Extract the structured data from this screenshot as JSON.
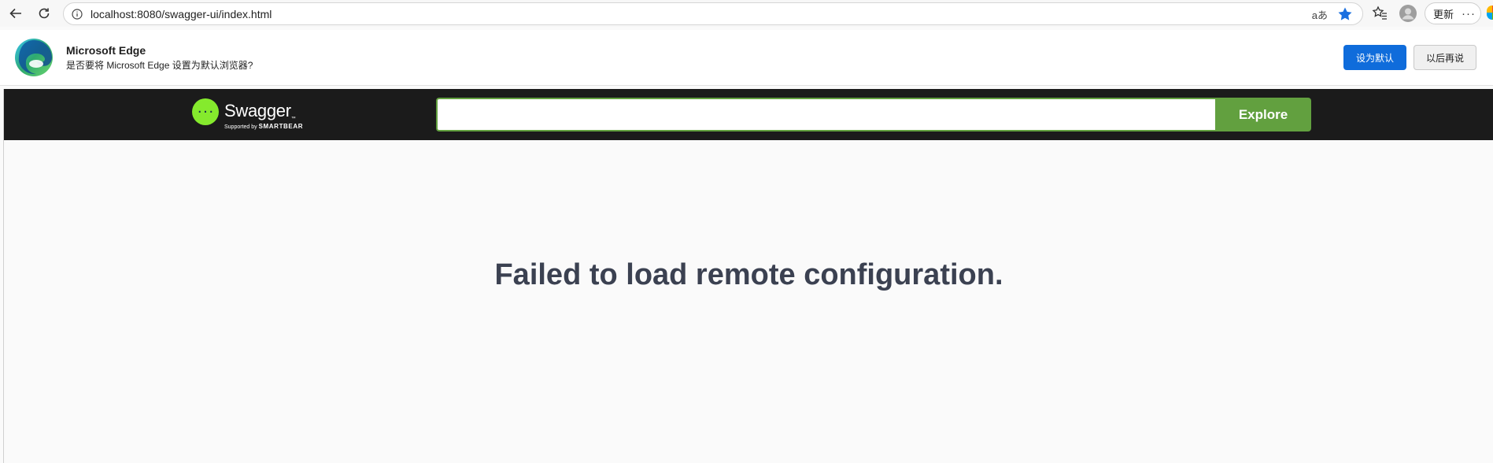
{
  "browser": {
    "url": "localhost:8080/swagger-ui/index.html",
    "read_aloud_label": "aあ",
    "update_label": "更新",
    "more_label": "···"
  },
  "infobar": {
    "title": "Microsoft Edge",
    "message": "是否要将 Microsoft Edge 设置为默认浏览器?",
    "set_default_label": "设为默认",
    "later_label": "以后再说"
  },
  "swagger": {
    "logo_text": "Swagger",
    "logo_tm": "™",
    "supported_by": "Supported by",
    "smartbear": "SMARTBEAR",
    "spec_input_value": "",
    "explore_label": "Explore",
    "error_message": "Failed to load remote configuration."
  },
  "colors": {
    "swagger_topbar": "#1b1b1b",
    "swagger_green": "#62a03f",
    "swagger_logo_green": "#85ea2d",
    "edge_primary": "#0f6cdb",
    "error_text": "#3b4151"
  }
}
